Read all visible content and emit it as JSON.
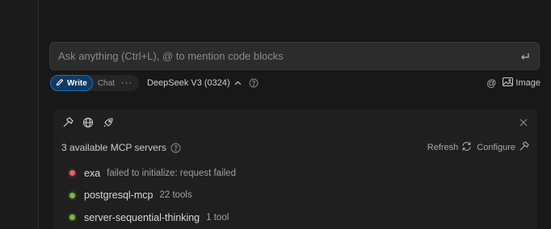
{
  "chat": {
    "placeholder": "Ask anything (Ctrl+L), @ to mention code blocks"
  },
  "toolbar": {
    "mode_write": "Write",
    "mode_chat": "Chat",
    "more": "···",
    "model": "DeepSeek V3 (0324)",
    "at": "@",
    "image": "Image"
  },
  "mcp": {
    "title": "3 available MCP servers",
    "refresh": "Refresh",
    "configure": "Configure",
    "servers": [
      {
        "name": "exa",
        "detail": "failed to initialize: request failed",
        "status": "error"
      },
      {
        "name": "postgresql-mcp",
        "detail": "22 tools",
        "status": "ok"
      },
      {
        "name": "server-sequential-thinking",
        "detail": "1 tool",
        "status": "ok"
      }
    ]
  },
  "colors": {
    "accent": "#1f6fb5",
    "status_error": "#e2636f",
    "status_ok": "#7ab648"
  }
}
